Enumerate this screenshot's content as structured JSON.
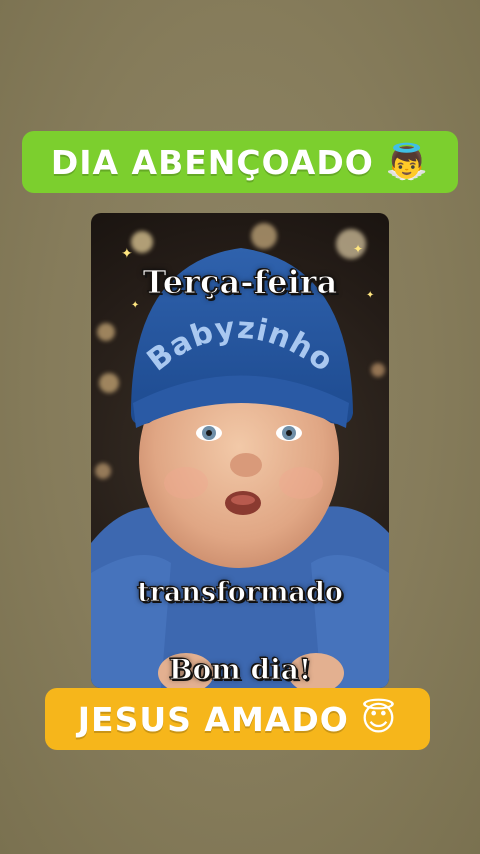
{
  "top_banner": {
    "text": "DIA ABENÇOADO",
    "emoji": "👼",
    "color": "#7ccf2e"
  },
  "photo": {
    "day_text": "Terça-feira",
    "hat_text": "Babyzinho",
    "caption": "transformado",
    "greeting": "Bom dia!"
  },
  "bottom_banner": {
    "text": "JESUS AMADO",
    "emoji": "😇",
    "color": "#f6b61b"
  }
}
